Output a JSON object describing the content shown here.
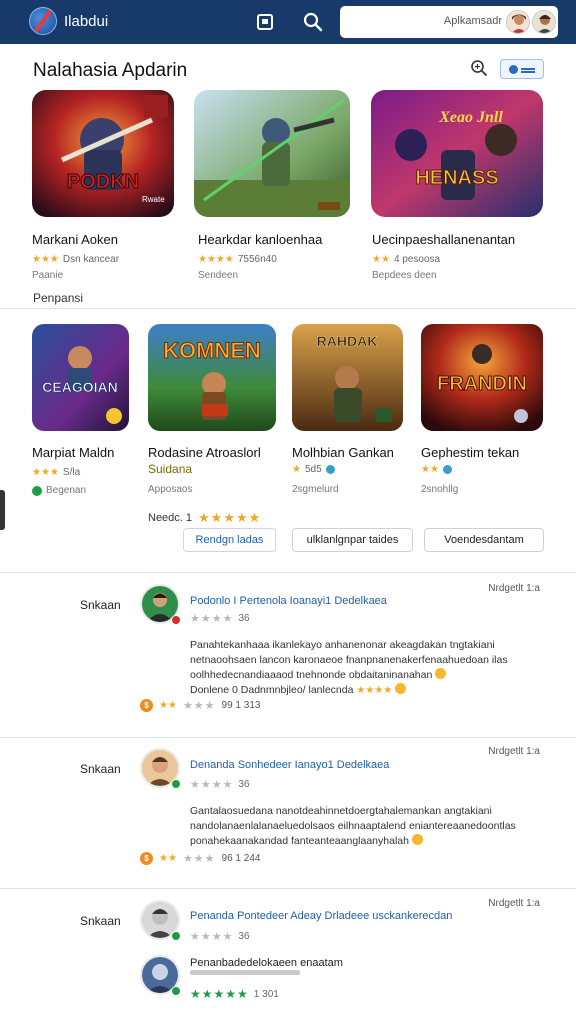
{
  "topbar": {
    "brand": "Ilabdui",
    "search_text": "Aplkamsadr"
  },
  "section": {
    "title": "Nalahasia Apdarin",
    "chip_icon": "eye-icon",
    "subtitle": "Penpansi"
  },
  "featured": [
    {
      "name": "Markani Aoken",
      "meta": "Dsn kancear",
      "sub": "Paanie",
      "art": "PODKN",
      "art_sub": "Rwate"
    },
    {
      "name": "Hearkdar kanloenhaa",
      "meta": "7556n40",
      "sub": "Sendeen",
      "art": "",
      "art_sub": ""
    },
    {
      "name": "Uecinpaeshallanenantan",
      "meta": "4 pesoosa",
      "sub": "Bepdees deen",
      "art": "HENASS",
      "art_sub": "Xeao Jnll"
    }
  ],
  "popular": [
    {
      "name": "Marpiat Maldn",
      "meta": "S/la",
      "sub": "Begenan",
      "art": "CEAGOIAN"
    },
    {
      "name": "Rodasine Atroaslorl",
      "meta": "Suidana",
      "sub": "Apposaos",
      "art": "KOMNEN"
    },
    {
      "name": "Molhbian Gankan",
      "meta": "5d5",
      "sub": "2sgmelurd",
      "art": "RAHDAK"
    },
    {
      "name": "Gephestim tekan",
      "meta": "",
      "sub": "2snohllg",
      "art": "FRANDIN"
    }
  ],
  "rating_label": "Needc. 1",
  "buttons": [
    "Rendgn ladas",
    "ulklanlgnpar taides",
    "Voendesdantam"
  ],
  "reviews": [
    {
      "label": "Snkaan",
      "title": "Podonlo I Pertenola Ioanayi1 Dedelkaea",
      "score": "36",
      "date": "Nrdgetlt 1:a",
      "body": "Panahtekanhaaa ikanlekayo anhanenonar akeagdakan tngtakiani netnaoohsaen lancon karonaeoe fnanpnanenakerfenaahuedoan ilas oolhhedecnandiaaaod tnehnonde obdaitaninanahan",
      "body_end": "Donlene 0 Dadnmnbjleo/ lanlecnda",
      "foot": "99 1 313"
    },
    {
      "label": "Snkaan",
      "title": "Denanda Sonhedeer Ianayo1 Dedelkaea",
      "score": "36",
      "date": "Nrdgetlt 1:a",
      "body": "Gantalaosuedana nanotdeahinnetdoergtahalemankan angtakiani nandolanaenlalanaeluedolsaos eilhnaaptalend eniantereaanedoontlas ponahekaanakandad fanteanteaanglaanyhalah",
      "body_end": "",
      "foot": "96 1 244"
    },
    {
      "label": "Snkaan",
      "title": "Penanda Pontedeer Adeay Drladeee  usckankerecdan",
      "score": "36",
      "date": "Nrdgetlt 1:a",
      "reply_title": "Penanbadedelokaeen enaatam",
      "reply_foot": "1 301"
    }
  ],
  "colors": {
    "topbar": "#173a6b",
    "link": "#1f5fa8",
    "star": "#f0a825",
    "green_star": "#1f9a46"
  }
}
